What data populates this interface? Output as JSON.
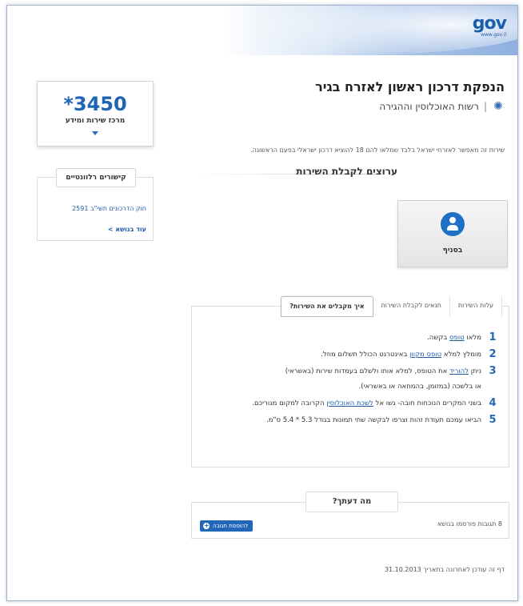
{
  "header": {
    "logo_text": "gov",
    "logo_sub": "www.gov.il"
  },
  "page": {
    "title": "הנפקת דרכון ראשון לאזרח בגיר",
    "authority": "רשות האוכלוסין וההגירה",
    "intro": "שירות זה מאפשר לאזרחי ישראל בלבד שמלאו להם 18 להוציא דרכון ישראלי בפעם הראשונה."
  },
  "channels": {
    "title": "ערוצים לקבלת השירות",
    "branch_label": "בסניף"
  },
  "tabs": [
    {
      "label": "איך מקבלים את השירות?",
      "active": true
    },
    {
      "label": "תנאים לקבלת השירות",
      "active": false
    },
    {
      "label": "עלות השירות",
      "active": false
    }
  ],
  "steps": {
    "s1": {
      "num": "1",
      "before": "מלאו ",
      "link": "טופס",
      "after": " בקשה."
    },
    "s2": {
      "num": "2",
      "before": "מומלץ למלא ",
      "link": "טופס מקוון",
      "after": " באינטרנט הכולל תשלום מוזל."
    },
    "s3": {
      "num": "3",
      "before": "ניתן ",
      "link": "להוריד",
      "after": " את הטופס, למלא אותו ולשלם בעמדות שירות (באשראי)",
      "cont": "או בלשכה (במזומן, בהמחאה או באשראי)."
    },
    "s4": {
      "num": "4",
      "before": "בשני המקרים הנוכחות חובה- גשו אל ",
      "link": "לשכת האוכלוסין",
      "after": " הקרובה למקום מגוריכם."
    },
    "s5": {
      "num": "5",
      "text": "הביאו עמכם תעודת זהות וצרפו לבקשה שתי תמונות בגודל 5.3 * 5.4 ס\"מ."
    }
  },
  "opinion": {
    "title": "מה דעתך?",
    "count": "8 תגובות פורסמו בנושא",
    "add_button": "להוספת תגובה"
  },
  "updated": "דף זה עודכן לאחרונה בתאריך 31.10.2013",
  "service_center": {
    "number": "*3450",
    "label": "מרכז שירות ומידע"
  },
  "links": {
    "title": "קישורים רלוונטיים",
    "item": "חוק הדרכונים תשי\"ב 2591",
    "more": "עוד בנושא >"
  },
  "colors": {
    "accent": "#1f65b6",
    "link": "#1d5aa8"
  }
}
